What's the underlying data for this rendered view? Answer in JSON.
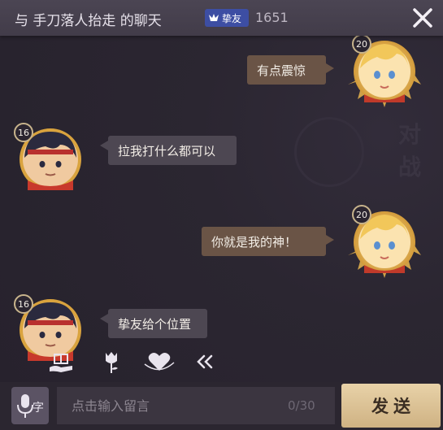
{
  "header": {
    "title": "与 手刀落人抬走 的聊天",
    "badge_label": "挚友",
    "friend_score": "1651",
    "close_icon": "close-icon"
  },
  "messages": [
    {
      "side": "right",
      "level": "20",
      "text": "有点震惊"
    },
    {
      "side": "left",
      "level": "16",
      "text": "拉我打什么都可以"
    },
    {
      "side": "right",
      "level": "20",
      "text": "你就是我的神！"
    },
    {
      "side": "left",
      "level": "16",
      "text": "挚友给个位置"
    }
  ],
  "actions": [
    "gift-icon",
    "flower-icon",
    "heart-icon",
    "collapse-icon"
  ],
  "input": {
    "placeholder": "点击输入留言",
    "count": "0/30",
    "send_label": "发送",
    "voice_icon": "mic-translate-icon"
  },
  "colors": {
    "header_bg": "#4b4553",
    "left_bubble": "#4d4752",
    "right_bubble": "#6a5446",
    "badge": "#3d4ea3",
    "send_button": "#dcc296"
  }
}
